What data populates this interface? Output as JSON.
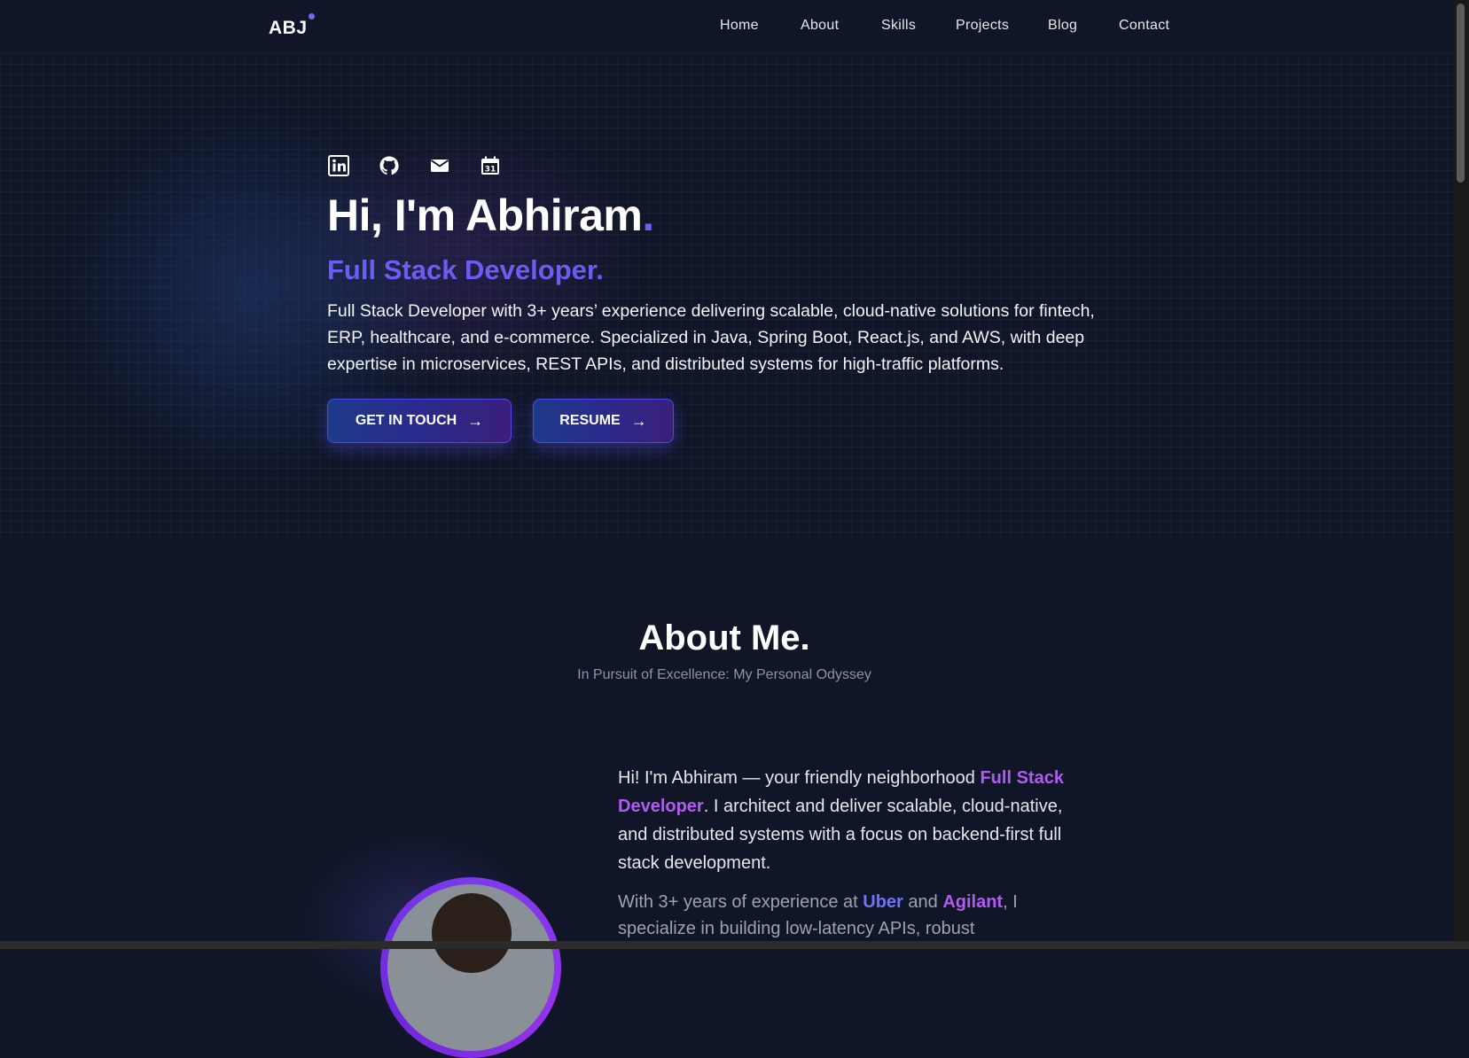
{
  "nav": {
    "logo": "ABJ",
    "links": [
      "Home",
      "About",
      "Skills",
      "Projects",
      "Blog",
      "Contact"
    ]
  },
  "hero": {
    "social_icons": [
      "linkedin-icon",
      "github-icon",
      "mail-icon",
      "calendar-icon"
    ],
    "calendar_day": "31",
    "title": "Hi, I'm Abhiram",
    "title_dot": ".",
    "subtitle": "Full Stack Developer.",
    "description": "Full Stack Developer with 3+ years’ experience delivering scalable, cloud-native solutions for fintech, ERP, healthcare, and e-commerce. Specialized in Java, Spring Boot, React.js, and AWS, with deep expertise in microservices, REST APIs, and distributed systems for high-traffic platforms.",
    "buttons": {
      "contact": "GET IN TOUCH",
      "resume": "RESUME",
      "arrow": "→"
    }
  },
  "about": {
    "title": "About Me.",
    "subtitle": "In Pursuit of Excellence: My Personal Odyssey",
    "p1_a": "Hi! I'm Abhiram — your friendly neighborhood ",
    "p1_hl": "Full Stack Developer",
    "p1_b": ". I architect and deliver scalable, cloud-native, and distributed systems with a focus on backend-first full stack development.",
    "p2_a": "With 3+ years of experience at ",
    "p2_uber": "Uber",
    "p2_and": " and ",
    "p2_agilant": "Agilant",
    "p2_b": ", I specialize in building low-latency APIs, robust"
  },
  "colors": {
    "background": "#101628",
    "accent": "#6a5ef0",
    "highlight_purple": "#b15cf0",
    "highlight_blue": "#6f73f5"
  }
}
